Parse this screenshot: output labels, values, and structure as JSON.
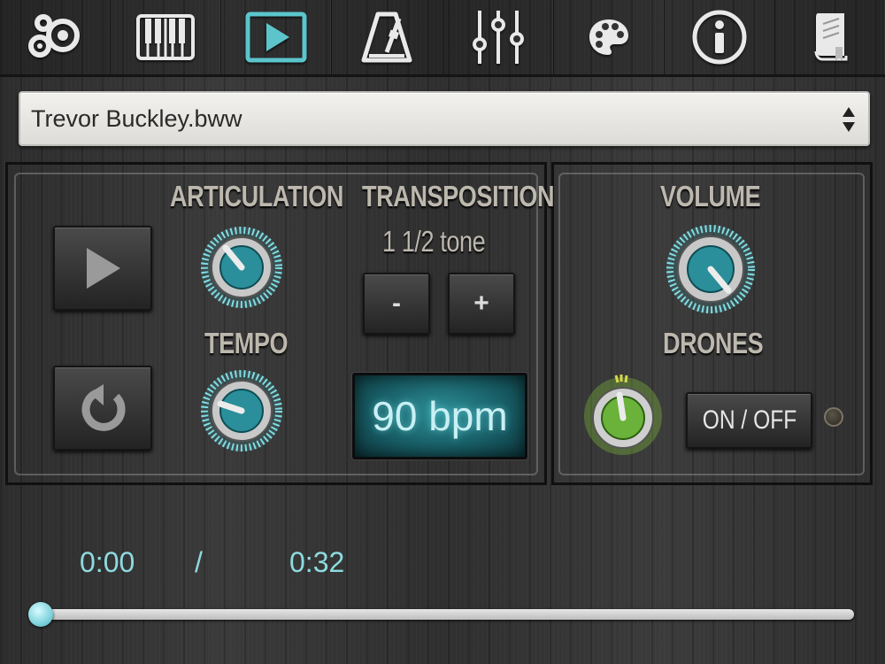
{
  "toolbar": {
    "items": [
      {
        "icon": "bagpipe-icon"
      },
      {
        "icon": "piano-keys-icon"
      },
      {
        "icon": "play-icon",
        "active": true
      },
      {
        "icon": "metronome-icon"
      },
      {
        "icon": "mixer-sliders-icon"
      },
      {
        "icon": "palette-icon"
      },
      {
        "icon": "info-icon"
      },
      {
        "icon": "book-icon"
      }
    ],
    "active_color": "#5cc5cc",
    "icon_color": "#e9e9e9"
  },
  "file_select": {
    "value": "Trevor Buckley.bww"
  },
  "controls": {
    "articulation_label": "ARTICULATION",
    "transposition_label": "TRANSPOSITION",
    "transposition_value": "1 1/2 tone",
    "minus_label": "-",
    "plus_label": "+",
    "tempo_label": "TEMPO",
    "tempo_value": "90 bpm",
    "play_icon": "play-icon",
    "repeat_icon": "repeat-icon"
  },
  "mixer": {
    "volume_label": "VOLUME",
    "drones_label": "DRONES",
    "drones_toggle_label": "ON / OFF",
    "knob_teal": "#2a8f9a",
    "knob_green": "#6ab23a"
  },
  "playback": {
    "current_time": "0:00",
    "separator": "/",
    "total_time": "0:32",
    "progress": 0.0
  }
}
